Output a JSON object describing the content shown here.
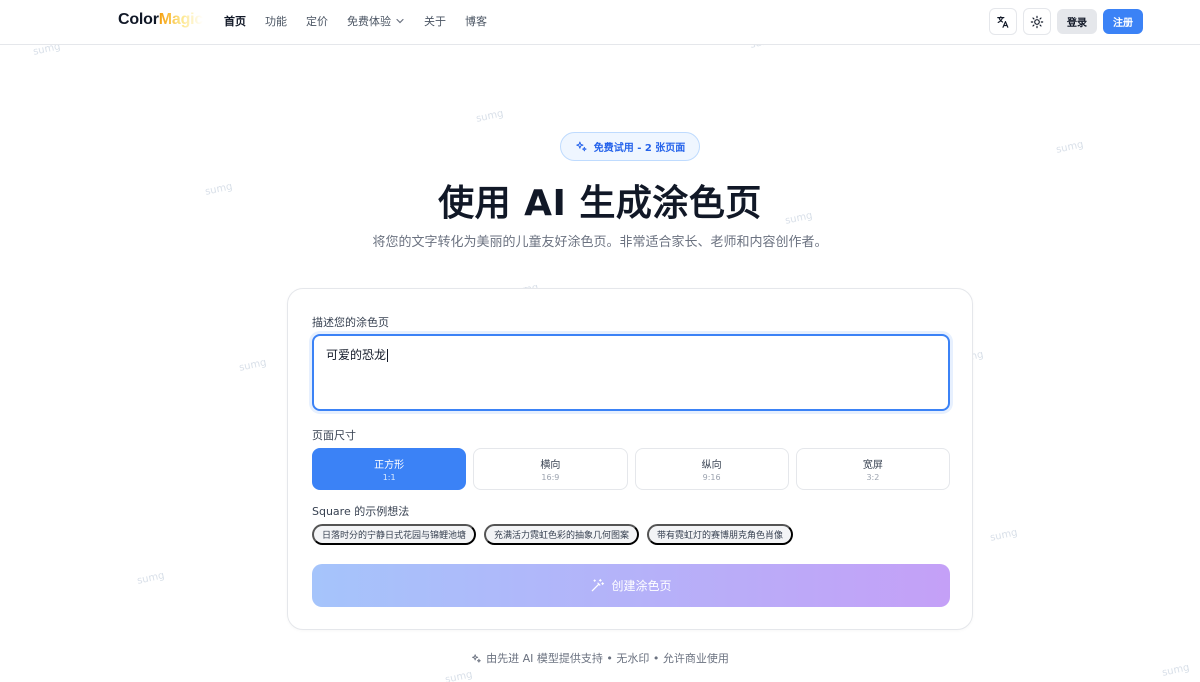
{
  "brand": {
    "part1": "Color",
    "part2": "Magic"
  },
  "nav": {
    "items": [
      {
        "label": "首页",
        "active": true
      },
      {
        "label": "功能"
      },
      {
        "label": "定价"
      },
      {
        "label": "免费体验",
        "dropdown": true
      },
      {
        "label": "关于"
      },
      {
        "label": "博客"
      }
    ]
  },
  "header": {
    "translate_icon": "translate-icon",
    "theme_icon": "sun-icon",
    "login_label": "登录",
    "signup_label": "注册"
  },
  "hero": {
    "badge": "免费试用 - 2 张页面",
    "title": "使用 AI 生成涂色页",
    "subtitle": "将您的文字转化为美丽的儿童友好涂色页。非常适合家长、老师和内容创作者。"
  },
  "form": {
    "prompt_label": "描述您的涂色页",
    "prompt_value": "可爱的恐龙",
    "size_label": "页面尺寸",
    "sizes": [
      {
        "name": "正方形",
        "ratio": "1:1",
        "selected": true
      },
      {
        "name": "横向",
        "ratio": "16:9"
      },
      {
        "name": "纵向",
        "ratio": "9:16"
      },
      {
        "name": "宽屏",
        "ratio": "3:2"
      }
    ],
    "examples_label": "Square 的示例想法",
    "examples": [
      "日落时分的宁静日式花园与锦鲤池塘",
      "充满活力霓虹色彩的抽象几何图案",
      "带有霓虹灯的赛博朋克角色肖像"
    ],
    "create_label": "创建涂色页"
  },
  "footer": {
    "note": "由先进 AI 模型提供支持 • 无水印 • 允许商业使用"
  },
  "watermark": "sumg",
  "colors": {
    "accent": "#3b82f6",
    "badge_bg": "#eff6ff",
    "create_from": "#a5c4fb",
    "create_to": "#c4a0f7"
  }
}
